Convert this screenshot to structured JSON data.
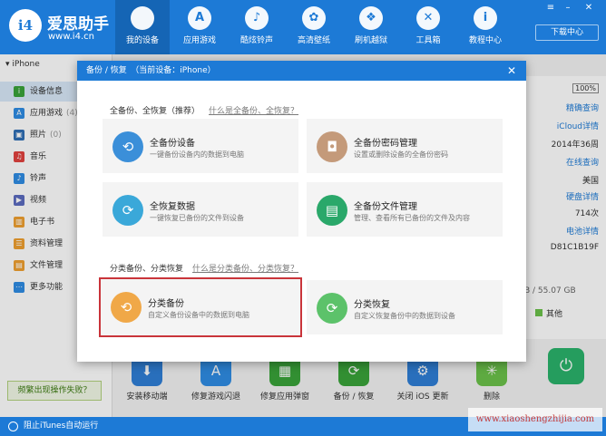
{
  "app": {
    "brand_title": "爱思助手",
    "brand_url": "www.i4.cn",
    "logo_text": "i4"
  },
  "nav": {
    "tabs": [
      {
        "label": "我的设备",
        "icon": "apple-icon",
        "glyph": ""
      },
      {
        "label": "应用游戏",
        "icon": "app-store-icon",
        "glyph": "A"
      },
      {
        "label": "酷炫铃声",
        "icon": "bell-icon",
        "glyph": "♪"
      },
      {
        "label": "高清壁纸",
        "icon": "flower-icon",
        "glyph": "✿"
      },
      {
        "label": "刷机越狱",
        "icon": "dropbox-icon",
        "glyph": "❖"
      },
      {
        "label": "工具箱",
        "icon": "tools-icon",
        "glyph": "✕"
      },
      {
        "label": "教程中心",
        "icon": "info-icon",
        "glyph": "i"
      }
    ],
    "download_label": "下载中心"
  },
  "sidebar": {
    "device_name": "iPhone",
    "items": [
      {
        "label": "设备信息",
        "count": "",
        "icon": "info-icon",
        "color": "#3aa33a"
      },
      {
        "label": "应用游戏",
        "count": "(4)",
        "icon": "app-store-icon",
        "color": "#2f8de4"
      },
      {
        "label": "照片",
        "count": "(0)",
        "icon": "photo-icon",
        "color": "#2f6fb5"
      },
      {
        "label": "音乐",
        "count": "",
        "icon": "music-icon",
        "color": "#e2433f"
      },
      {
        "label": "铃声",
        "count": "",
        "icon": "bell-icon",
        "color": "#2f8de4"
      },
      {
        "label": "视频",
        "count": "",
        "icon": "video-icon",
        "color": "#5c6bc0"
      },
      {
        "label": "电子书",
        "count": "",
        "icon": "book-icon",
        "color": "#f0a030"
      },
      {
        "label": "资料管理",
        "count": "",
        "icon": "contacts-icon",
        "color": "#f0a030"
      },
      {
        "label": "文件管理",
        "count": "",
        "icon": "folder-icon",
        "color": "#f0a030"
      },
      {
        "label": "更多功能",
        "count": "",
        "icon": "more-icon",
        "color": "#2f8de4"
      }
    ],
    "freq_button": "频繁出现操作失败？"
  },
  "bottombar": {
    "label": "阻止iTunes自动运行"
  },
  "info_panel": {
    "pct": "100%",
    "rows": [
      "精确查询",
      "iCloud详情",
      "2014年36周",
      "在线查询",
      "美国",
      "硬盘详情",
      "714次",
      "电池详情",
      "D81C1B19F"
    ],
    "storage": "B / 55.07 GB",
    "other_label": "其他"
  },
  "tools": [
    {
      "label": "安装移动端",
      "icon": "install-icon",
      "color": "#2f7fd6"
    },
    {
      "label": "修复游戏闪退",
      "icon": "app-store-icon",
      "color": "#2f8de4"
    },
    {
      "label": "修复应用弹窗",
      "icon": "apple-id-icon",
      "color": "#3aa33a"
    },
    {
      "label": "备份 / 恢复",
      "icon": "backup-icon",
      "color": "#3aa33a"
    },
    {
      "label": "关闭 iOS 更新",
      "icon": "gear-icon",
      "color": "#2f7fd6"
    },
    {
      "label": "删除",
      "icon": "loading-icon",
      "color": "#6cc24a"
    }
  ],
  "dialog": {
    "title": "备份 / 恢复　（当前设备：iPhone）",
    "section1_title": "全备份、全恢复（推荐）",
    "section1_link": "什么是全备份、全恢复？",
    "section2_title": "分类备份、分类恢复",
    "section2_link": "什么是分类备份、分类恢复？",
    "cards": [
      {
        "title": "全备份设备",
        "desc": "一键备份设备内的数据到电脑",
        "icon": "full-backup-icon",
        "color": "#3b8fd9",
        "glyph": "⟲"
      },
      {
        "title": "全备份密码管理",
        "desc": "设置或删除设备的全备份密码",
        "icon": "lock-icon",
        "color": "#c49a7a",
        "glyph": "🔒"
      },
      {
        "title": "全恢复数据",
        "desc": "一键恢复已备份的文件到设备",
        "icon": "full-restore-icon",
        "color": "#3aa8d9",
        "glyph": "⟳"
      },
      {
        "title": "全备份文件管理",
        "desc": "管理、查看所有已备份的文件及内容",
        "icon": "folder-icon",
        "color": "#2aa86a",
        "glyph": "▤"
      },
      {
        "title": "分类备份",
        "desc": "自定义备份设备中的数据到电脑",
        "icon": "category-backup-icon",
        "color": "#f0a848",
        "glyph": "⟲"
      },
      {
        "title": "分类恢复",
        "desc": "自定义恢复备份中的数据到设备",
        "icon": "category-restore-icon",
        "color": "#5cc26a",
        "glyph": "⟳"
      }
    ]
  },
  "watermark": "www.xiaoshengzhijia.com"
}
